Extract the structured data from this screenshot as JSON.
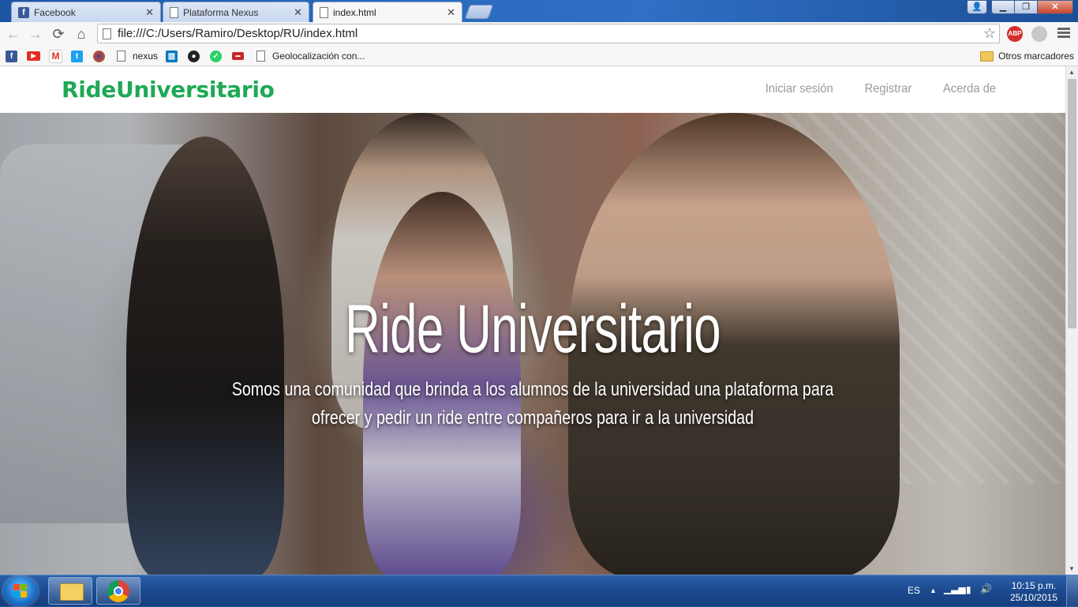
{
  "browser": {
    "tabs": [
      {
        "title": "Facebook",
        "favicon": "facebook-icon"
      },
      {
        "title": "Plataforma Nexus",
        "favicon": "document-icon"
      },
      {
        "title": "index.html",
        "favicon": "document-icon",
        "active": true
      }
    ],
    "address": "file:///C:/Users/Ramiro/Desktop/RU/index.html",
    "bookmarks": [
      {
        "label": "",
        "icon": "facebook-icon"
      },
      {
        "label": "",
        "icon": "youtube-icon"
      },
      {
        "label": "",
        "icon": "gmail-icon"
      },
      {
        "label": "",
        "icon": "twitter-icon"
      },
      {
        "label": "",
        "icon": "firefox-icon"
      },
      {
        "label": "nexus",
        "icon": "document-icon"
      },
      {
        "label": "",
        "icon": "trello-icon"
      },
      {
        "label": "",
        "icon": "github-icon"
      },
      {
        "label": "",
        "icon": "whatsapp-icon"
      },
      {
        "label": "",
        "icon": "site-icon"
      },
      {
        "label": "Geolocalización con...",
        "icon": "document-icon"
      }
    ],
    "other_bookmarks": "Otros marcadores",
    "extension_abp": "ABP"
  },
  "site": {
    "brand": "RideUniversitario",
    "nav": [
      "Iniciar sesión",
      "Registrar",
      "Acerda de"
    ],
    "hero": {
      "title": "Ride Universitario",
      "subtitle": "Somos una comunidad que brinda a los alumnos de la universidad una plataforma para ofrecer y pedir un ride entre compañeros para ir a la universidad"
    }
  },
  "taskbar": {
    "language": "ES",
    "time": "10:15 p.m.",
    "date": "25/10/2015"
  },
  "colors": {
    "brand": "#1ea954",
    "nav_link": "#9a9a9a",
    "taskbar": "#1c4a8f"
  }
}
